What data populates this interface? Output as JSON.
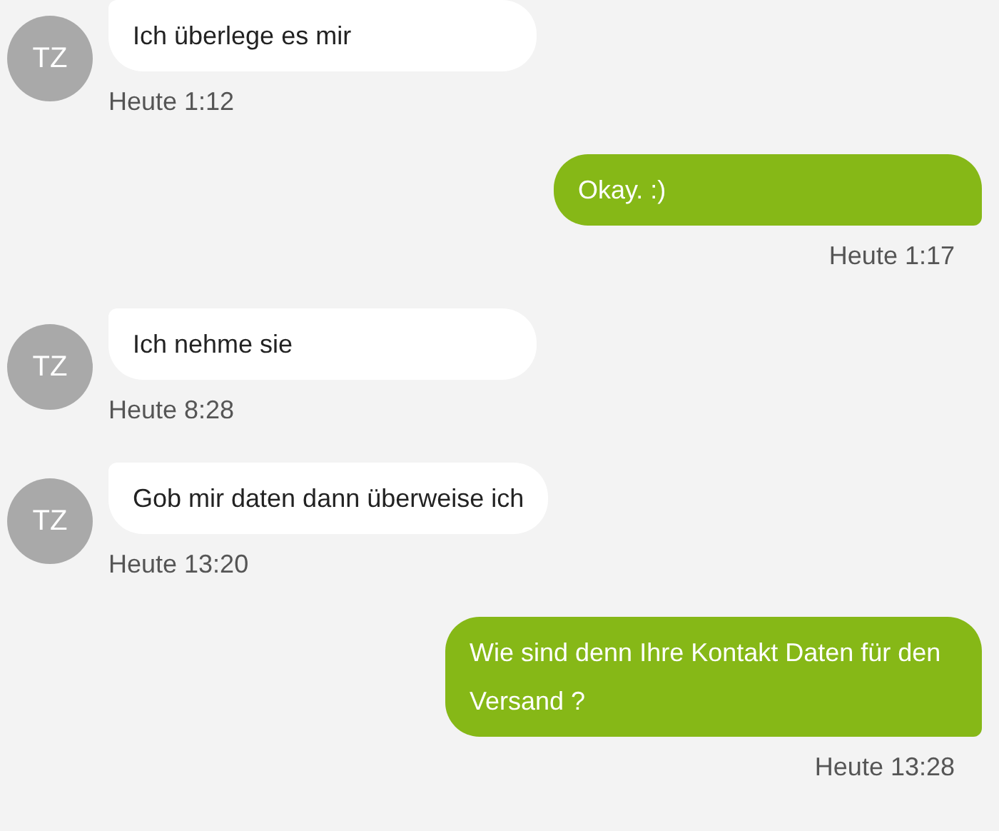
{
  "messages": [
    {
      "kind": "incoming",
      "avatar": "TZ",
      "text": "Ich überlege es mir",
      "time": "Heute 1:12"
    },
    {
      "kind": "outgoing",
      "text": "Okay. :)",
      "time": "Heute 1:17"
    },
    {
      "kind": "incoming",
      "avatar": "TZ",
      "text": "Ich nehme sie",
      "time": "Heute 8:28"
    },
    {
      "kind": "incoming",
      "avatar": "TZ",
      "text": "Gob mir daten dann überweise ich",
      "time": "Heute 13:20"
    },
    {
      "kind": "outgoing",
      "text": "Wie sind denn Ihre Kontakt Daten für den Versand ?",
      "time": "Heute 13:28"
    }
  ]
}
